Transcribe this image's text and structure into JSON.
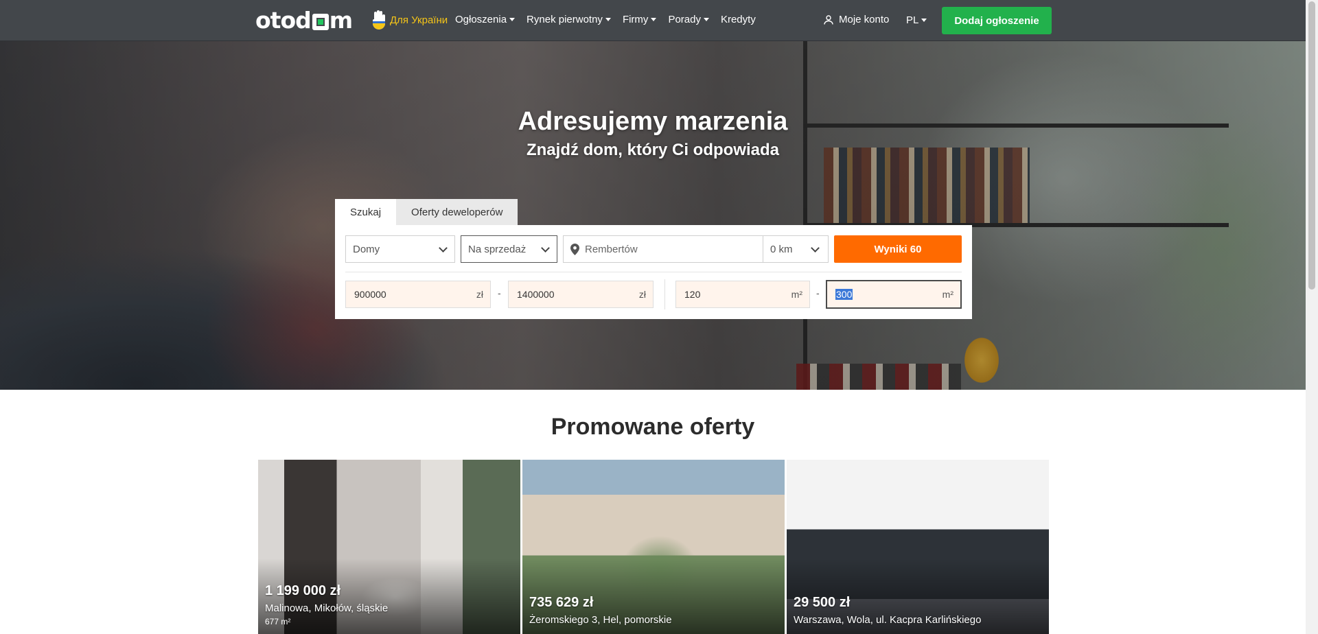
{
  "header": {
    "ua_label": "Для України",
    "nav": [
      {
        "label": "Ogłoszenia",
        "dropdown": true
      },
      {
        "label": "Rynek pierwotny",
        "dropdown": true
      },
      {
        "label": "Firmy",
        "dropdown": true
      },
      {
        "label": "Porady",
        "dropdown": true
      },
      {
        "label": "Kredyty",
        "dropdown": false
      }
    ],
    "account_label": "Moje konto",
    "lang": "PL",
    "add_button": "Dodaj ogłoszenie",
    "brand_color": "#22b14c"
  },
  "hero": {
    "title": "Adresujemy marzenia",
    "subtitle": "Znajdź dom, który Ci odpowiada"
  },
  "search": {
    "tabs": [
      "Szukaj",
      "Oferty deweloperów"
    ],
    "property_type": "Domy",
    "transaction": "Na sprzedaż",
    "location": "Rembertów",
    "distance": "0 km",
    "results_button": "Wyniki 60",
    "results_color": "#ff6a00",
    "price_from": "900000",
    "price_to": "1400000",
    "price_unit": "zł",
    "area_from": "120",
    "area_to": "300",
    "area_unit": "m²",
    "range_dash": "-"
  },
  "promoted": {
    "title": "Promowane oferty",
    "offers": [
      {
        "price": "1 199 000 zł",
        "address": "Malinowa, Mikołów, śląskie",
        "area": "677 m²"
      },
      {
        "price": "735 629 zł",
        "address": "Żeromskiego 3, Hel, pomorskie",
        "area": ""
      },
      {
        "price": "29 500 zł",
        "address": "Warszawa, Wola, ul. Kacpra Karlińskiego",
        "area": ""
      }
    ]
  }
}
